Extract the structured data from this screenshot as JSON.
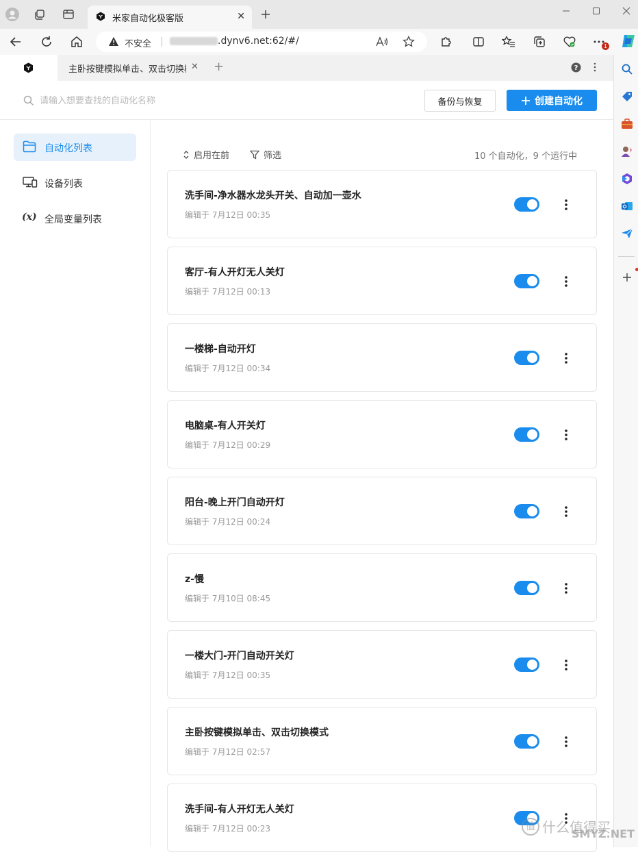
{
  "browser": {
    "tab_title": "米家自动化极客版",
    "address": {
      "security_label": "不安全",
      "url_suffix": ".dynv6.net:62/#/"
    },
    "notification_badge": "1"
  },
  "app_tabs": {
    "second_tab_label": "主卧按键模拟单击、双击切换模式"
  },
  "header": {
    "search_placeholder": "请输入想要查找的自动化名称",
    "backup_label": "备份与恢复",
    "create_label": "创建自动化"
  },
  "nav": {
    "items": [
      {
        "label": "自动化列表",
        "icon": "folder-icon",
        "active": true
      },
      {
        "label": "设备列表",
        "icon": "devices-icon",
        "active": false
      },
      {
        "label": "全局变量列表",
        "icon": "variable-icon",
        "active": false
      }
    ],
    "variable_symbol": "(x)"
  },
  "toolbar": {
    "sort_label": "启用在前",
    "filter_label": "筛选",
    "summary": "10 个自动化，9 个运行中"
  },
  "automations": [
    {
      "title": "洗手间-净水器水龙头开关、自动加一壶水",
      "time": "编辑于 7月12日 00:35",
      "enabled": true
    },
    {
      "title": "客厅-有人开灯无人关灯",
      "time": "编辑于 7月12日 00:13",
      "enabled": true
    },
    {
      "title": "一楼梯-自动开灯",
      "time": "编辑于 7月12日 00:34",
      "enabled": true
    },
    {
      "title": "电脑桌-有人开关灯",
      "time": "编辑于 7月12日 00:29",
      "enabled": true
    },
    {
      "title": "阳台-晚上开门自动开灯",
      "time": "编辑于 7月12日 00:24",
      "enabled": true
    },
    {
      "title": "z-慢",
      "time": "编辑于 7月10日 08:45",
      "enabled": true
    },
    {
      "title": "一楼大门-开门自动开关灯",
      "time": "编辑于 7月12日 00:35",
      "enabled": true
    },
    {
      "title": "主卧按键模拟单击、双击切换模式",
      "time": "编辑于 7月12日 02:57",
      "enabled": true
    },
    {
      "title": "洗手间-有人开灯无人关灯",
      "time": "编辑于 7月12日 00:23",
      "enabled": true
    }
  ],
  "watermark": {
    "text": "什么值得买",
    "badge": "值",
    "url": "SMYZ.NET"
  },
  "colors": {
    "accent": "#1a8ced",
    "active_nav_bg": "#e6f1fc"
  }
}
